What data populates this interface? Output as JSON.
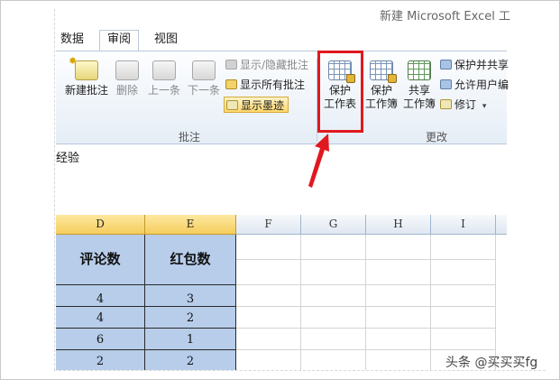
{
  "window": {
    "title": "新建 Microsoft Excel 工"
  },
  "tabs": [
    {
      "label": "数据",
      "active": false
    },
    {
      "label": "审阅",
      "active": true
    },
    {
      "label": "视图",
      "active": false
    }
  ],
  "ribbon": {
    "comments_group": {
      "label": "批注",
      "new_comment": "新建批注",
      "delete": "删除",
      "previous": "上一条",
      "next": "下一条",
      "show_hide_comment": "显示/隐藏批注",
      "show_all_comments": "显示所有批注",
      "show_ink": "显示墨迹"
    },
    "changes_group": {
      "label": "更改",
      "protect_sheet": [
        "保护",
        "工作表"
      ],
      "protect_workbook": [
        "保护",
        "工作簿"
      ],
      "share_workbook": [
        "共享",
        "工作簿"
      ],
      "protect_and_share": "保护并共享",
      "allow_users": "允许用户编",
      "track_changes": "修订"
    }
  },
  "annotation": {
    "color": "#e0191f",
    "target": "protect_sheet"
  },
  "partial_cell_text": "经验",
  "sheet": {
    "columns": [
      "D",
      "E",
      "F",
      "G",
      "H",
      "I"
    ],
    "selected_columns": [
      "D",
      "E"
    ],
    "header_row": [
      "评论数",
      "红包数"
    ],
    "rows": [
      [
        "4",
        "3"
      ],
      [
        "4",
        "2"
      ],
      [
        "6",
        "1"
      ],
      [
        "2",
        "2"
      ]
    ],
    "fill_color": "#b7cdea"
  },
  "watermark": "头条 @买买买fg"
}
